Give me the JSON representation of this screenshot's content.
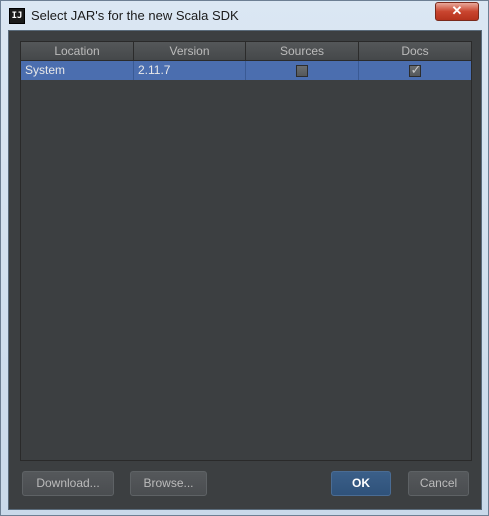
{
  "window": {
    "title": "Select JAR's for the new Scala SDK",
    "app_icon_text": "IJ",
    "close_glyph": "✕"
  },
  "table": {
    "columns": [
      "Location",
      "Version",
      "Sources",
      "Docs"
    ],
    "rows": [
      {
        "location": "System",
        "version": "2.11.7",
        "sources_checked": false,
        "docs_checked": true
      }
    ]
  },
  "buttons": {
    "download": "Download...",
    "browse": "Browse...",
    "ok": "OK",
    "cancel": "Cancel"
  },
  "checkmark_glyph": "✓",
  "colors": {
    "panel_bg": "#3c3f41",
    "selection": "#4b6eaf",
    "primary_button": "#365880"
  }
}
